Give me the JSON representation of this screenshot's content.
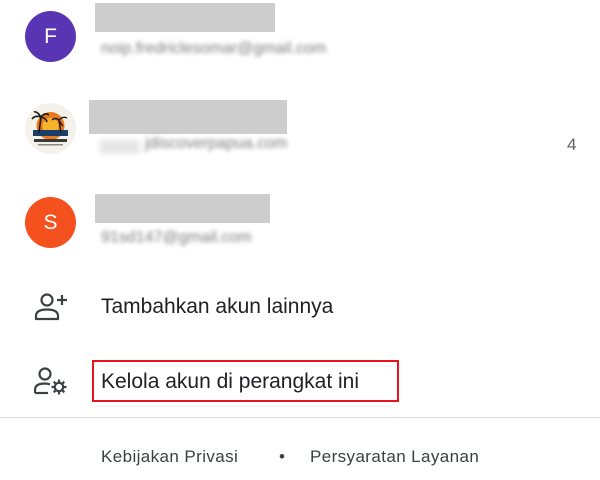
{
  "accounts": [
    {
      "avatar_letter": "F",
      "avatar_color": "#5a35b3",
      "email": "noip.fredriclesomar@gmail.com"
    },
    {
      "avatar_letter": "",
      "avatar_color": "#f3f3f3",
      "avatar_image": "sunset-palm-logo",
      "email": "jdiscoverpapua.com",
      "count": "4"
    },
    {
      "avatar_letter": "S",
      "avatar_color": "#f4511e",
      "email": "91sd147@gmail.com"
    }
  ],
  "actions": {
    "add_account_label": "Tambahkan akun lainnya",
    "add_account_icon": "person-add-icon",
    "manage_accounts_label": "Kelola akun di perangkat ini",
    "manage_accounts_icon": "person-settings-icon"
  },
  "highlight_color": "#e8141d",
  "footer": {
    "privacy_label": "Kebijakan Privasi",
    "separator": "•",
    "terms_label": "Persyaratan Layanan"
  }
}
